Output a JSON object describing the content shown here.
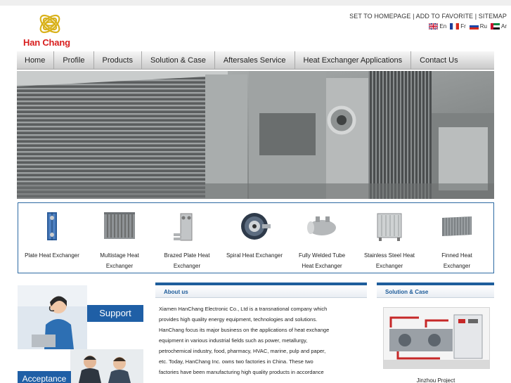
{
  "brand": {
    "name": "Han Chang",
    "color": "#d81e1e",
    "logo_color": "#d9b21c"
  },
  "toplinks": {
    "homepage": "SET TO HOMEPAGE",
    "sep1": " | ",
    "favorite": "ADD TO FAVORITE",
    "sep2": " | ",
    "sitemap": "SITEMAP"
  },
  "languages": [
    {
      "label": "En",
      "icon": "uk-flag-icon"
    },
    {
      "label": "Fr",
      "icon": "france-flag-icon"
    },
    {
      "label": "Ru",
      "icon": "russia-flag-icon"
    },
    {
      "label": "Ar",
      "icon": "uae-flag-icon"
    }
  ],
  "nav": [
    {
      "label": "Home"
    },
    {
      "label": "Profile"
    },
    {
      "label": "Products"
    },
    {
      "label": "Solution & Case"
    },
    {
      "label": "Aftersales Service"
    },
    {
      "label": "Heat Exchanger Applications"
    },
    {
      "label": "Contact Us"
    }
  ],
  "products": [
    {
      "line1": "Plate Heat Exchanger",
      "line2": ""
    },
    {
      "line1": "Multistage Heat",
      "line2": "Exchanger"
    },
    {
      "line1": "Brazed Plate Heat",
      "line2": "Exchanger"
    },
    {
      "line1": "Spiral Heat Exchanger",
      "line2": ""
    },
    {
      "line1": "Fully Welded Tube",
      "line2": "Heat Exchanger"
    },
    {
      "line1": "Stainless Steel Heat",
      "line2": "Exchanger"
    },
    {
      "line1": "Finned Heat",
      "line2": "Exchanger"
    }
  ],
  "side": {
    "support": "Support",
    "acceptance": "Acceptance"
  },
  "about": {
    "title": "About us",
    "lines": [
      "Xiamen HanChang Electronic Co., Ltd is a transnational company which",
      "provides high quality energy equipment, technologies and solutions.",
      "HanChang focus its major business on the applications of heat exchange",
      "equipment in various industrial fields such as power, metallurgy,",
      "petrochemical industry, food, pharmacy, HVAC, marine, pulp and paper,",
      "etc. Today, HanChang Inc. owns two factories in China. These two",
      "factories have been manufacturing high quality products in accordance"
    ]
  },
  "solution": {
    "title": "Solution & Case",
    "caption": "Jinzhou Project"
  },
  "colors": {
    "accent": "#1e5d9c",
    "label_bg": "#1f5fa6"
  }
}
